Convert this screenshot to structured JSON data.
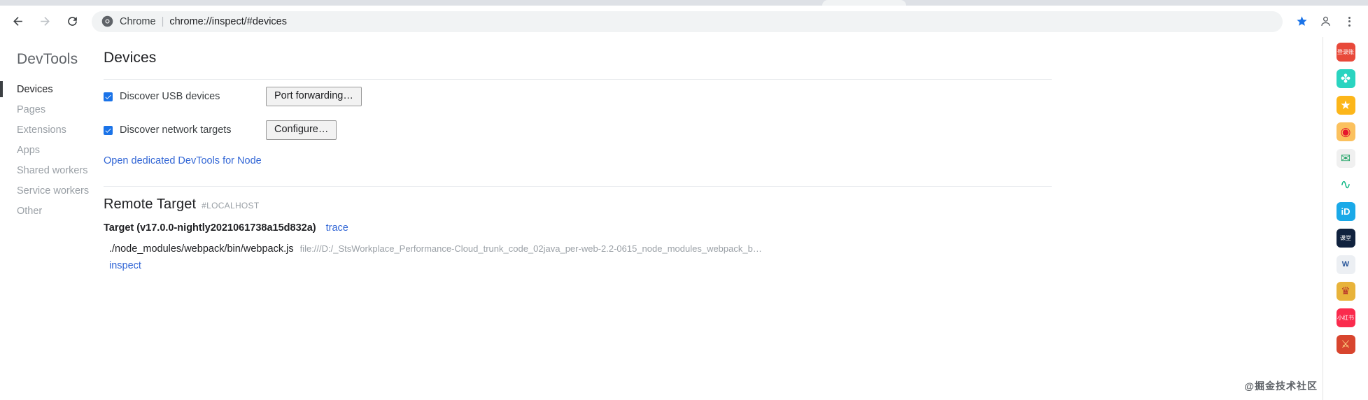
{
  "browser": {
    "back_icon": "back-arrow-icon",
    "forward_icon": "forward-arrow-icon",
    "reload_icon": "reload-icon",
    "omnibox": {
      "chrome_icon": "chrome-logo-icon",
      "label": "Chrome",
      "separator": "|",
      "url": "chrome://inspect/#devices"
    },
    "bookmark_icon": "star-filled-icon",
    "profile_icon": "profile-avatar-icon",
    "menu_icon": "three-dot-menu-icon"
  },
  "sidebar": {
    "title": "DevTools",
    "items": [
      {
        "label": "Devices",
        "selected": true
      },
      {
        "label": "Pages",
        "selected": false
      },
      {
        "label": "Extensions",
        "selected": false
      },
      {
        "label": "Apps",
        "selected": false
      },
      {
        "label": "Shared workers",
        "selected": false
      },
      {
        "label": "Service workers",
        "selected": false
      },
      {
        "label": "Other",
        "selected": false
      }
    ]
  },
  "main": {
    "page_title": "Devices",
    "options": [
      {
        "label": "Discover USB devices",
        "checked": true,
        "button": "Port forwarding…",
        "button_name": "port-forwarding-button"
      },
      {
        "label": "Discover network targets",
        "checked": true,
        "button": "Configure…",
        "button_name": "configure-button"
      }
    ],
    "node_link": "Open dedicated DevTools for Node",
    "remote_target": {
      "title": "Remote Target",
      "subtitle": "#LOCALHOST",
      "targets": [
        {
          "name": "Target (v17.0.0-nightly2021061738a15d832a)",
          "trace_label": "trace",
          "path": "./node_modules/webpack/bin/webpack.js",
          "url": "file:///D:/_StsWorkplace_Performance-Cloud_trunk_code_02java_per-web-2.2-0615_node_modules_webpack_b…",
          "inspect_label": "inspect"
        }
      ]
    }
  },
  "right_rail": {
    "icons": [
      {
        "name": "login-account-icon",
        "glyph": "登录账",
        "bg": "#e8493a",
        "fg": "#ffffff",
        "size": "8px"
      },
      {
        "name": "clover-extension-icon",
        "glyph": "✤",
        "bg": "#2ad4c0",
        "fg": "#ffffff",
        "size": "17px"
      },
      {
        "name": "star-extension-icon",
        "glyph": "★",
        "bg": "#fcb61a",
        "fg": "#ffffff",
        "size": "17px"
      },
      {
        "name": "weibo-extension-icon",
        "glyph": "◉",
        "bg": "#fbc15e",
        "fg": "#e6162d",
        "size": "17px"
      },
      {
        "name": "mail-extension-icon",
        "glyph": "✉",
        "bg": "#f0f0f0",
        "fg": "#21a366",
        "size": "17px"
      },
      {
        "name": "cloud-extension-icon",
        "glyph": "∿",
        "bg": "#ffffff",
        "fg": "#12b886",
        "size": "19px"
      },
      {
        "name": "id-extension-icon",
        "glyph": "iD",
        "bg": "#1aa9e8",
        "fg": "#ffffff",
        "size": "13px"
      },
      {
        "name": "wangjiao-extension-icon",
        "glyph": "课堂",
        "bg": "#10223e",
        "fg": "#ffffff",
        "size": "8px"
      },
      {
        "name": "word-doc-extension-icon",
        "glyph": "W",
        "bg": "#eceff3",
        "fg": "#2b579a",
        "size": "11px"
      },
      {
        "name": "game-avatar-extension-icon",
        "glyph": "♛",
        "bg": "#e8b33a",
        "fg": "#b9352a",
        "size": "15px"
      },
      {
        "name": "xiaohongshu-extension-icon",
        "glyph": "小红书",
        "bg": "#fa2b4d",
        "fg": "#ffffff",
        "size": "8px"
      },
      {
        "name": "game2-extension-icon",
        "glyph": "⚔",
        "bg": "#d8452e",
        "fg": "#ffe08a",
        "size": "15px"
      }
    ]
  },
  "watermark": "@掘金技术社区"
}
